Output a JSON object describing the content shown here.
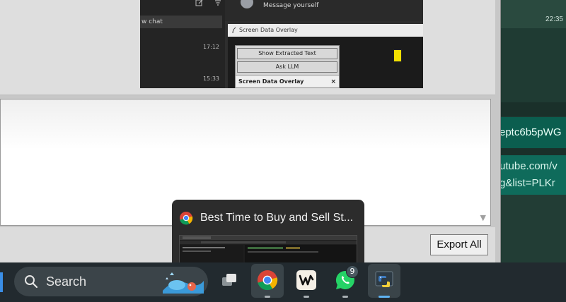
{
  "backdrop": {
    "time": "22:35",
    "link_1": "eptc6b5pWG",
    "link_2_line1": "utube.com/v",
    "link_2_line2": "g&list=PLKr"
  },
  "embedded_screenshot": {
    "chat_list": {
      "new_chat": "w chat",
      "times": [
        "17:12",
        "15:33"
      ]
    },
    "chat_header": {
      "subtitle": "Message yourself"
    },
    "overlay_tab": "Screen Data Overlay",
    "panel": {
      "buttons": [
        "Show Extracted Text",
        "Ask LLM"
      ],
      "title": "Screen Data Overlay",
      "close": "×"
    }
  },
  "main": {
    "export_label": "Export All",
    "scroll_arrow": "▼"
  },
  "thumbnail": {
    "title": "Best Time to Buy and Sell St..."
  },
  "taskbar": {
    "search_label": "Search",
    "items": [
      {
        "name": "task-view",
        "icon": "task-view-icon"
      },
      {
        "name": "chrome",
        "icon": "chrome-icon",
        "active": true
      },
      {
        "name": "wispr",
        "icon": "wispr-icon"
      },
      {
        "name": "whatsapp",
        "icon": "whatsapp-icon",
        "badge": "9"
      },
      {
        "name": "python",
        "icon": "python-icon",
        "active": true
      }
    ]
  },
  "colors": {
    "taskbar": "#222a2f",
    "accent": "#5fb3f2",
    "whatsapp": "#25d366",
    "teal_link": "#0b5e4f"
  }
}
